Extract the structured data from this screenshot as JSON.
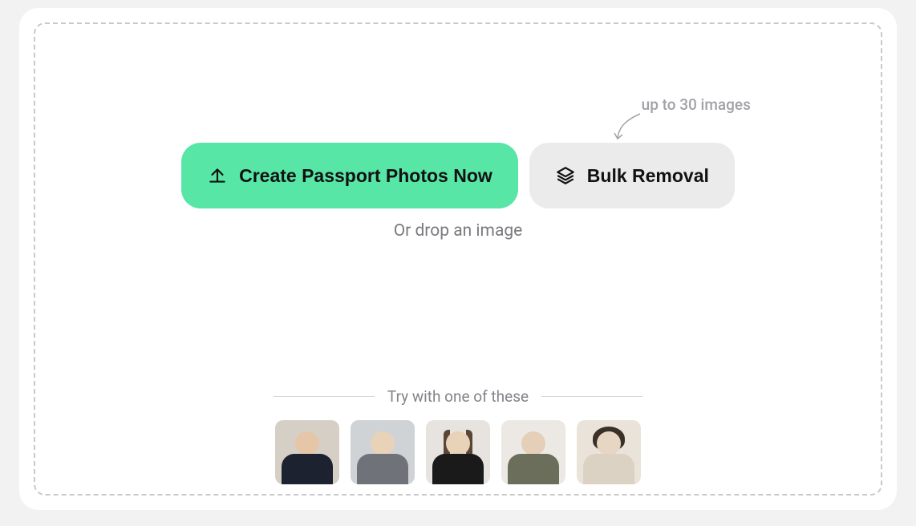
{
  "buttons": {
    "create": "Create Passport Photos Now",
    "bulk": "Bulk Removal"
  },
  "callout": "up to 30 images",
  "dropHint": "Or drop an image",
  "samplesHeading": "Try with one of these",
  "samples": [
    {
      "name": "sample-photo-1"
    },
    {
      "name": "sample-photo-2"
    },
    {
      "name": "sample-photo-3"
    },
    {
      "name": "sample-photo-4"
    },
    {
      "name": "sample-photo-5"
    }
  ],
  "colors": {
    "primary": "#58e6a7",
    "secondary": "#ebebeb"
  }
}
